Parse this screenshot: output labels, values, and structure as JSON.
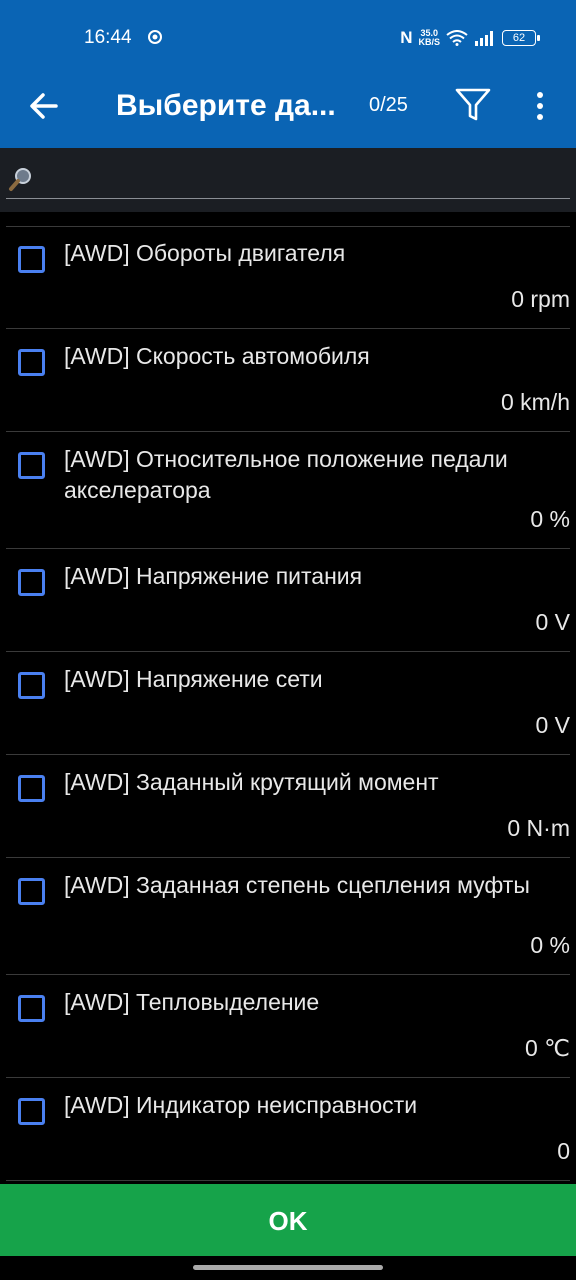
{
  "status_bar": {
    "time": "16:44",
    "nfc": "N",
    "speed_value": "35.0",
    "speed_unit": "KB/S",
    "battery": "62"
  },
  "app_bar": {
    "title": "Выберите да...",
    "counter": "0/25"
  },
  "search": {
    "placeholder": ""
  },
  "items": [
    {
      "label": "[AWD] Обороты двигателя",
      "value": "0 rpm"
    },
    {
      "label": "[AWD] Скорость автомобиля",
      "value": "0 km/h"
    },
    {
      "label": "[AWD] Относительное положение педали акселератора",
      "value": "0 %"
    },
    {
      "label": "[AWD] Напряжение питания",
      "value": "0 V"
    },
    {
      "label": "[AWD] Напряжение сети",
      "value": "0 V"
    },
    {
      "label": "[AWD] Заданный крутящий момент",
      "value": "0 N·m"
    },
    {
      "label": "[AWD] Заданная степень сцепления муфты",
      "value": "0 %"
    },
    {
      "label": "[AWD] Тепловыделение",
      "value": "0 ℃"
    },
    {
      "label": "[AWD] Индикатор неисправности",
      "value": "0"
    }
  ],
  "ok_label": "OK",
  "colors": {
    "primary": "#0a64b4",
    "checkbox": "#4a80f0",
    "ok": "#16a34a"
  }
}
